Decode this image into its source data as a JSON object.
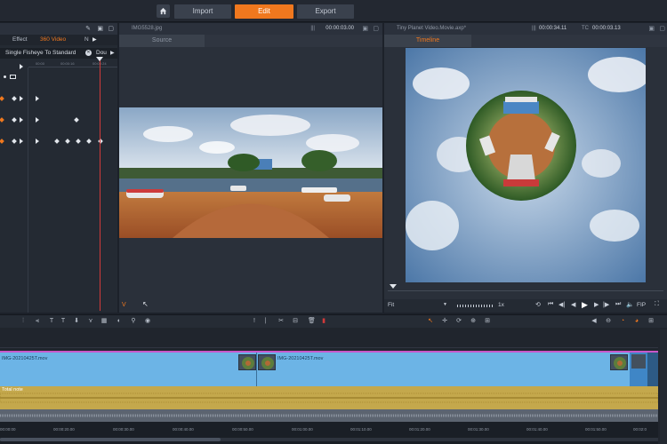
{
  "topbar": {
    "tabs": [
      {
        "label": "Import"
      },
      {
        "label": "Edit"
      },
      {
        "label": "Export"
      }
    ]
  },
  "left_panel": {
    "tab_effect": "Effect",
    "tab_360": "360 Video",
    "tab_n": "N",
    "effect_name": "Single Fisheye To Standard",
    "effect_aux": "Dou",
    "ruler_ticks": [
      "00:00",
      "00:00:16",
      "00:00:24"
    ]
  },
  "source_panel": {
    "filename": "IMG5528.jpg",
    "timecode": "00:00:03.00",
    "tab": "Source"
  },
  "player_panel": {
    "filename": "Tiny Planet Video.Movie.axp*",
    "duration": "00:00:34.11",
    "tc_label": "TC",
    "timecode": "00:00:03.13",
    "tab": "Timeline",
    "fit": "Fit",
    "speed": "1x",
    "fip": "FIP"
  },
  "timeline": {
    "clip1": "IMG-20210425T.mov",
    "clip2": "IMG-20210425T.mov",
    "audio_label": "Total note",
    "timecodes": [
      "00:00:00",
      "00:00:20.00",
      "00:00:30.00",
      "00:00:40.00",
      "00:00:50.00",
      "00:01:00.00",
      "00:01:10.00",
      "00:01:20.00",
      "00:01:30.00",
      "00:01:40.00",
      "00:01:50.00",
      "00:02:0"
    ]
  },
  "colors": {
    "accent": "#f0781e",
    "video_track": "#6cb4e6",
    "audio_track": "#c4a84c",
    "playhead": "#d13a3a"
  }
}
